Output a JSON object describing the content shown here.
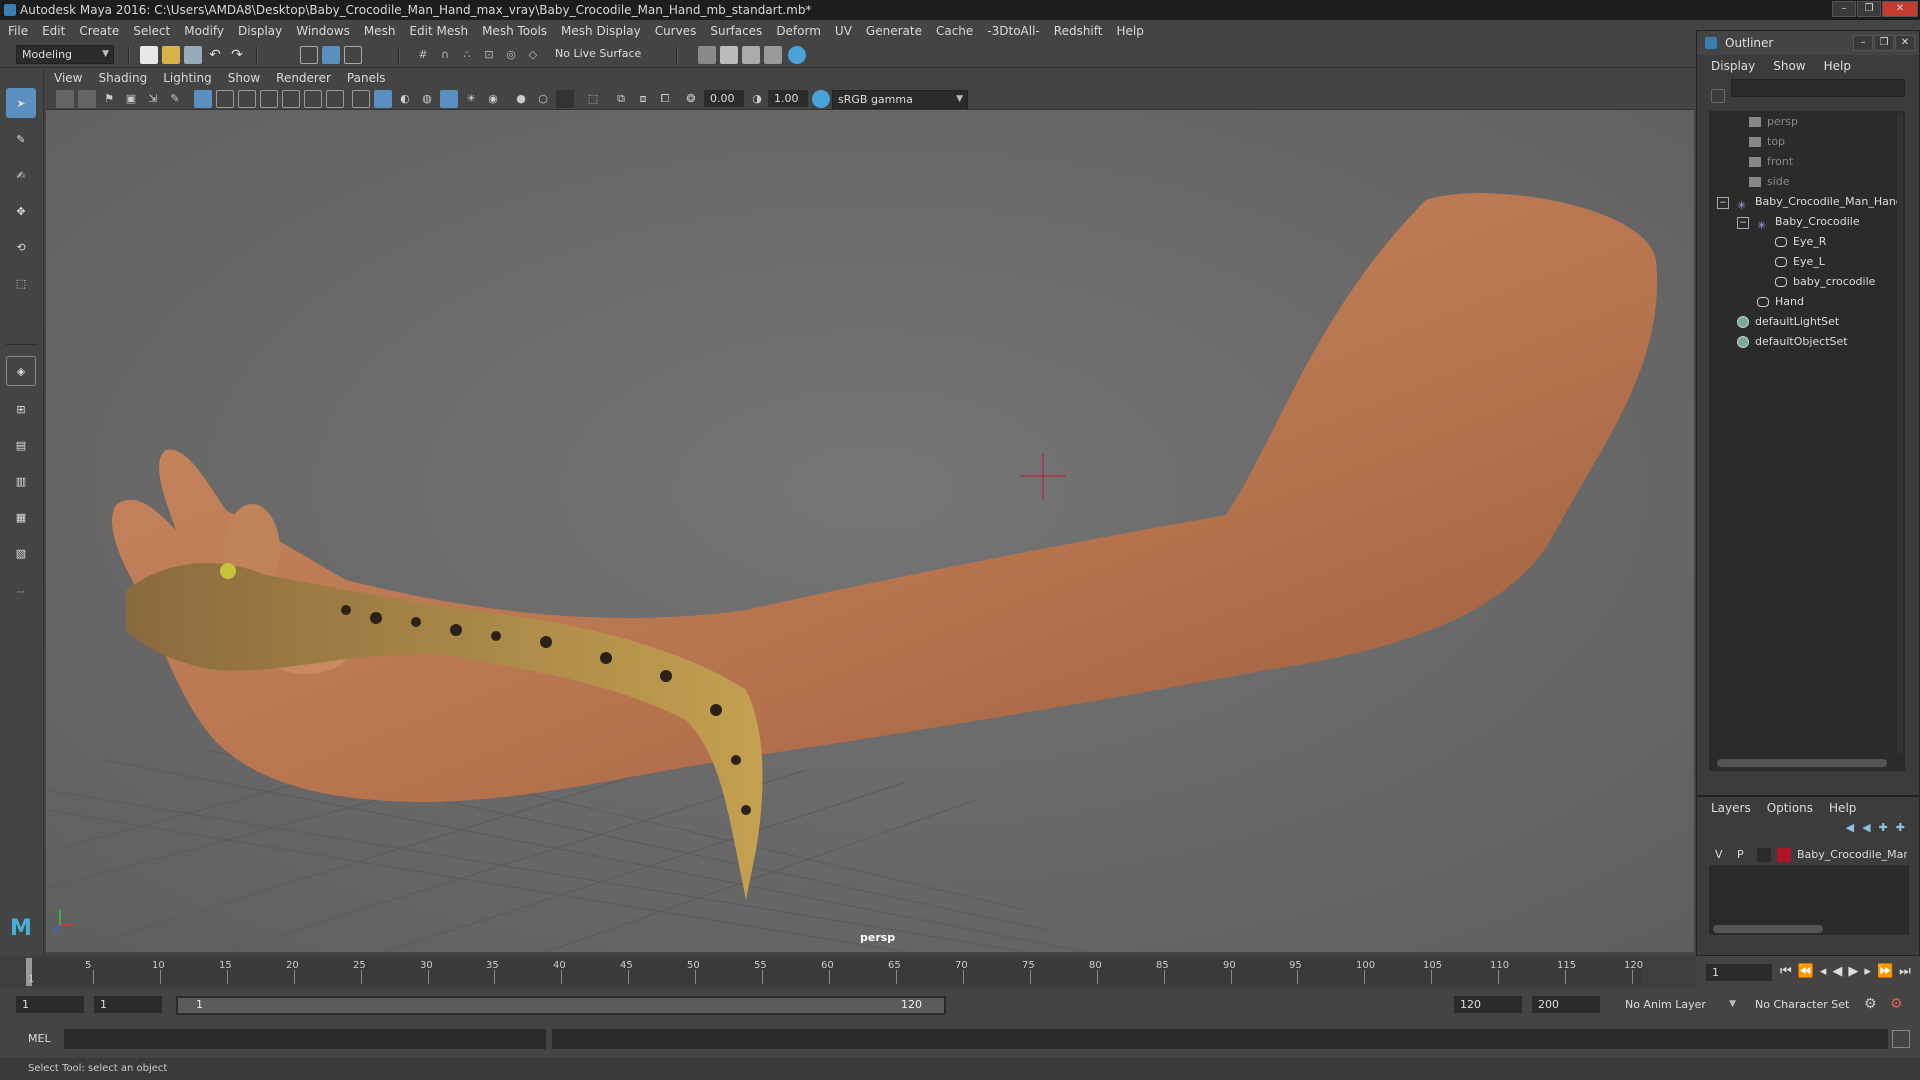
{
  "title": "Autodesk Maya 2016: C:\\Users\\AMDA8\\Desktop\\Baby_Crocodile_Man_Hand_max_vray\\Baby_Crocodile_Man_Hand_mb_standart.mb*",
  "menubar": [
    "File",
    "Edit",
    "Create",
    "Select",
    "Modify",
    "Display",
    "Windows",
    "Mesh",
    "Edit Mesh",
    "Mesh Tools",
    "Mesh Display",
    "Curves",
    "Surfaces",
    "Deform",
    "UV",
    "Generate",
    "Cache",
    "-3DtoAll-",
    "Redshift",
    "Help"
  ],
  "shelf": {
    "mode": "Modeling",
    "live_surface": "No Live Surface"
  },
  "panel_menu": [
    "View",
    "Shading",
    "Lighting",
    "Show",
    "Renderer",
    "Panels"
  ],
  "panel_toolbar": {
    "exposure": "0.00",
    "gamma": "1.00",
    "color_space": "sRGB gamma"
  },
  "viewport": {
    "camera_label": "persp"
  },
  "outliner": {
    "title": "Outliner",
    "menu": [
      "Display",
      "Show",
      "Help"
    ],
    "items": [
      {
        "label": "persp",
        "dim": true
      },
      {
        "label": "top",
        "dim": true
      },
      {
        "label": "front",
        "dim": true
      },
      {
        "label": "side",
        "dim": true
      },
      {
        "label": "Baby_Crocodile_Man_Hand"
      },
      {
        "label": "Baby_Crocodile"
      },
      {
        "label": "Eye_R"
      },
      {
        "label": "Eye_L"
      },
      {
        "label": "baby_crocodile"
      },
      {
        "label": "Hand"
      },
      {
        "label": "defaultLightSet"
      },
      {
        "label": "defaultObjectSet"
      }
    ]
  },
  "layers": {
    "menu": [
      "Layers",
      "Options",
      "Help"
    ],
    "layer": {
      "v": "V",
      "p": "P",
      "name": "Baby_Crocodile_Man_Hand",
      "color": "#b0122a"
    }
  },
  "timeline": {
    "ticks": [
      "5",
      "10",
      "15",
      "20",
      "25",
      "30",
      "35",
      "40",
      "45",
      "50",
      "55",
      "60",
      "65",
      "70",
      "75",
      "80",
      "85",
      "90",
      "95",
      "100",
      "105",
      "110",
      "115",
      "120"
    ],
    "start_label": "1",
    "current_frame": "1"
  },
  "range": {
    "start": "1",
    "playback_start": "1",
    "slider_start": "1",
    "slider_end": "120",
    "playback_end": "120",
    "end": "200",
    "anim_layer": "No Anim Layer",
    "char_set": "No Character Set"
  },
  "cmd": {
    "label": "MEL"
  },
  "status": "Select Tool: select an object"
}
